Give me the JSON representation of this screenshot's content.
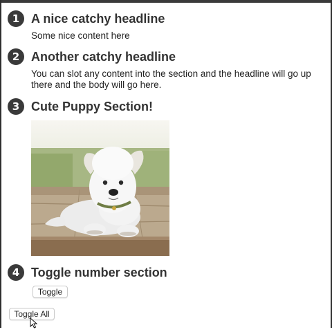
{
  "sections": [
    {
      "number": "1",
      "headline": "A nice catchy headline",
      "body": "Some nice content here"
    },
    {
      "number": "2",
      "headline": "Another catchy headline",
      "body": "You can slot any content into the section and the headline will go up there and the body will go here."
    },
    {
      "number": "3",
      "headline": "Cute Puppy Section!"
    },
    {
      "number": "4",
      "headline": "Toggle number section",
      "button_label": "Toggle"
    }
  ],
  "toggle_all_label": "Toggle All",
  "colors": {
    "badge": "#3a3a3a",
    "headline": "#333333",
    "frame": "#2f2f2f"
  },
  "icons": {
    "cursor": "pointer-cursor-icon"
  }
}
